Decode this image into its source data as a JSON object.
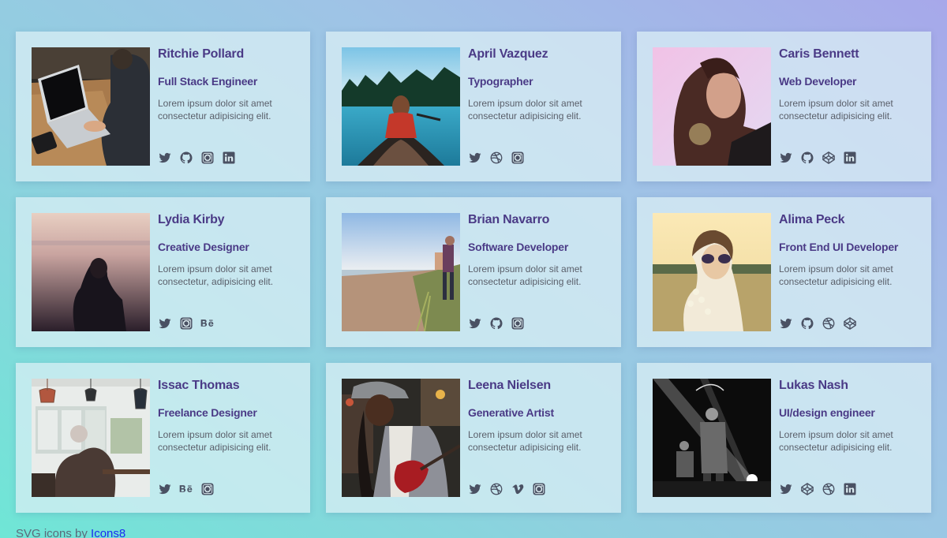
{
  "cards": [
    {
      "name": "Ritchie Pollard",
      "role": "Full Stack Engineer",
      "bio": "Lorem ipsum dolor sit amet consectetur adipisicing elit.",
      "photo": "laptop-photo",
      "socials": [
        "twitter-icon",
        "github-icon",
        "instagram-icon",
        "linkedin-icon"
      ]
    },
    {
      "name": "April Vazquez",
      "role": "Typographer",
      "bio": "Lorem ipsum dolor sit amet consectetur adipisicing elit.",
      "photo": "canoe-photo",
      "socials": [
        "twitter-icon",
        "dribbble-icon",
        "instagram-icon"
      ]
    },
    {
      "name": "Caris Bennett",
      "role": "Web Developer",
      "bio": "Lorem ipsum dolor sit amet consectetur adipisicing elit.",
      "photo": "portrait-photo",
      "socials": [
        "twitter-icon",
        "github-icon",
        "codepen-icon",
        "linkedin-icon"
      ]
    },
    {
      "name": "Lydia Kirby",
      "role": "Creative Designer",
      "bio": "Lorem ipsum dolor sit amet consectetur, adipisicing elit.",
      "photo": "city-view-photo",
      "socials": [
        "twitter-icon",
        "instagram-icon",
        "behance-icon"
      ]
    },
    {
      "name": "Brian Navarro",
      "role": "Software Developer",
      "bio": "Lorem ipsum dolor sit amet consectetur adipisicing elit.",
      "photo": "beach-photo",
      "socials": [
        "twitter-icon",
        "github-icon",
        "instagram-icon"
      ]
    },
    {
      "name": "Alima Peck",
      "role": "Front End UI Developer",
      "bio": "Lorem ipsum dolor sit amet consectetur adipisicing elit.",
      "photo": "sunglasses-photo",
      "socials": [
        "twitter-icon",
        "github-icon",
        "dribbble-icon",
        "codepen-icon"
      ]
    },
    {
      "name": "Issac Thomas",
      "role": "Freelance Designer",
      "bio": "Lorem ipsum dolor sit amet consectetur adipisicing elit.",
      "photo": "cafe-photo",
      "socials": [
        "twitter-icon",
        "behance-icon",
        "instagram-icon"
      ]
    },
    {
      "name": "Leena Nielsen",
      "role": "Generative Artist",
      "bio": "Lorem ipsum dolor sit amet consectetur adipisicing elit.",
      "photo": "guitar-photo",
      "socials": [
        "twitter-icon",
        "dribbble-icon",
        "vimeo-icon",
        "instagram-icon"
      ]
    },
    {
      "name": "Lukas Nash",
      "role": "UI/design engineer",
      "bio": "Lorem ipsum dolor sit amet consectetur adipisicing elit.",
      "photo": "concert-photo",
      "socials": [
        "twitter-icon",
        "codepen-icon",
        "dribbble-icon",
        "linkedin-icon"
      ]
    }
  ],
  "footer": {
    "text": "SVG icons by ",
    "link": "Icons8"
  },
  "colors": {
    "name": "#4a3a86",
    "icon": "#4a5163",
    "link": "#1a2cf0"
  }
}
